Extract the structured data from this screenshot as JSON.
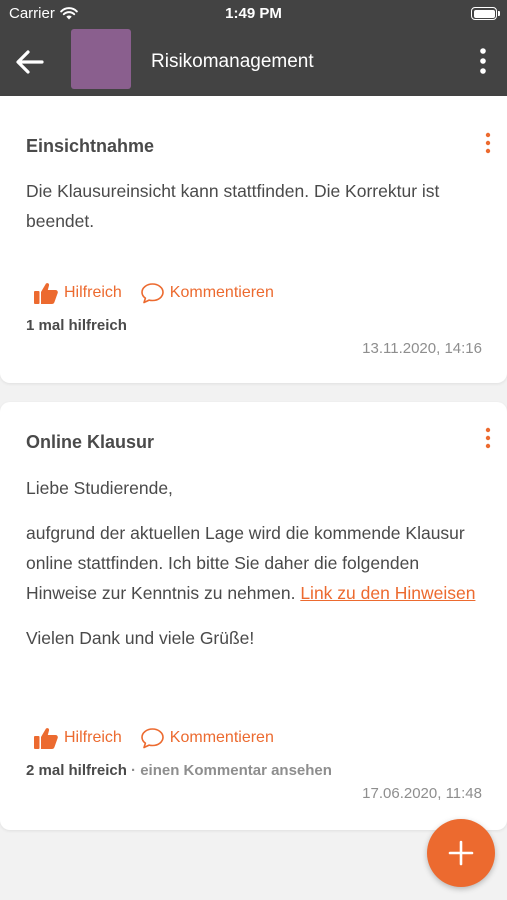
{
  "status_bar": {
    "carrier": "Carrier",
    "time": "1:49 PM"
  },
  "nav": {
    "title": "Risikomanagement",
    "icons": [
      "back-arrow-icon",
      "more-vertical-icon"
    ]
  },
  "colors": {
    "accent": "#ec6a2f",
    "header": "#434343",
    "thumbnail": "#8a5f8e"
  },
  "posts": [
    {
      "title": "Einsichtnahme",
      "paragraphs": [
        "Die Klausureinsicht kann stattfinden. Die Korrektur ist beendet."
      ],
      "helpful_label": "Hilfreich",
      "comment_label": "Kommentieren",
      "helpful_count": "1 mal hilfreich",
      "date": "13.11.2020, 14:16"
    },
    {
      "title": "Online Klausur",
      "greeting": "Liebe Studierende,",
      "body_text": "aufgrund der aktuellen Lage wird die kommende Klausur online stattfinden. Ich bitte Sie daher die folgenden Hinweise zur Kenntnis zu nehmen.",
      "link_text": "Link zu den Hinweisen",
      "closing": "Vielen Dank und viele Grüße!",
      "helpful_label": "Hilfreich",
      "comment_label": "Kommentieren",
      "helpful_count": "2 mal hilfreich",
      "view_comment": "· einen Kommentar ansehen",
      "date": "17.06.2020, 11:48"
    }
  ],
  "fab": {
    "icon": "plus-icon"
  }
}
